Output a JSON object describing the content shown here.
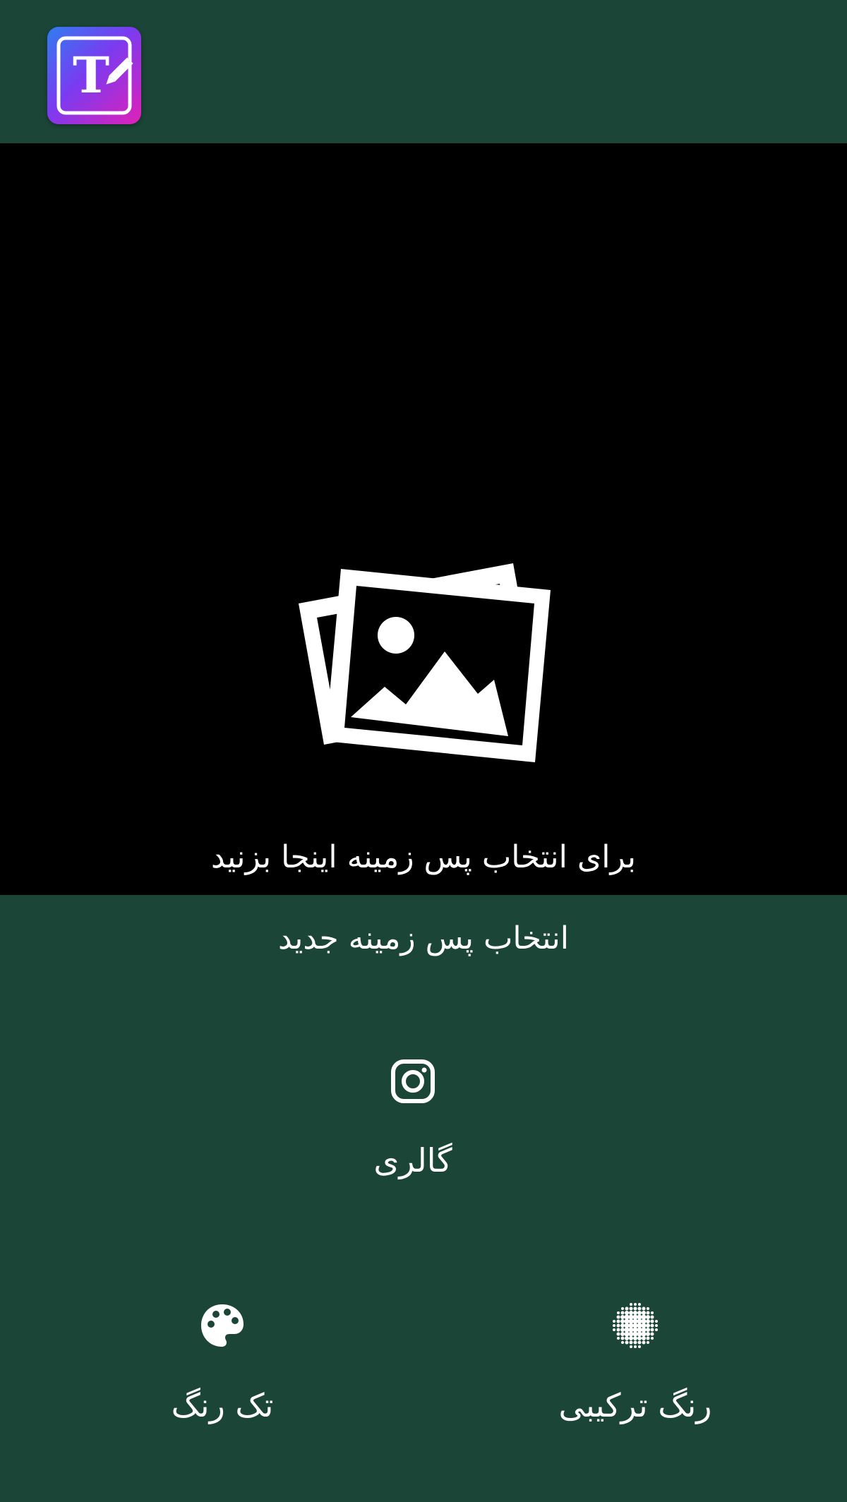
{
  "app": {
    "logo_icon": "text-editor-logo-icon",
    "logo_letter": "T"
  },
  "preview": {
    "placeholder_icon": "photo-library-icon",
    "hint": "برای انتخاب پس زمینه اینجا بزنید"
  },
  "background_picker": {
    "title": "انتخاب پس زمینه جدید",
    "options": {
      "gallery": {
        "icon": "instagram-icon",
        "label": "گالری"
      },
      "single_color": {
        "icon": "palette-icon",
        "label": "تک رنگ"
      },
      "gradient_color": {
        "icon": "halftone-dots-icon",
        "label": "رنگ ترکیبی"
      }
    }
  },
  "colors": {
    "background": "#1b4537",
    "preview_background": "#000000",
    "text": "#ffffff"
  }
}
